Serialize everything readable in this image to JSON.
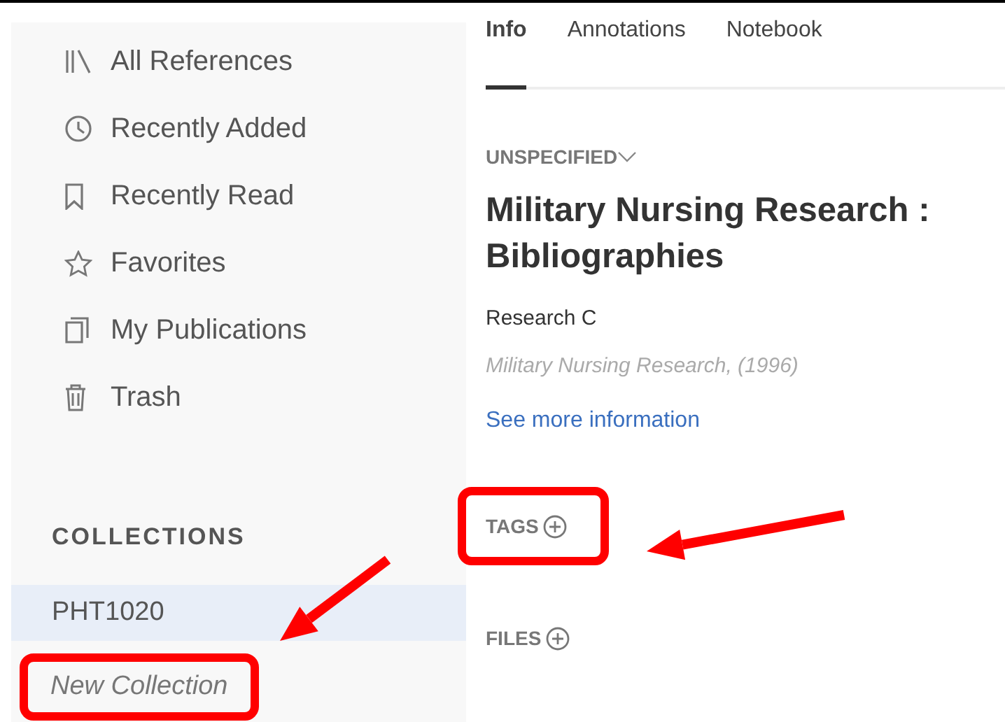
{
  "sidebar": {
    "library_items": [
      {
        "label": "All References"
      },
      {
        "label": "Recently Added"
      },
      {
        "label": "Recently Read"
      },
      {
        "label": "Favorites"
      },
      {
        "label": "My Publications"
      },
      {
        "label": "Trash"
      }
    ],
    "collections_heading": "COLLECTIONS",
    "collections": [
      {
        "label": "PHT1020",
        "kind": "collection",
        "selected": true,
        "highlighted": false
      },
      {
        "label": "New Collection",
        "kind": "new",
        "selected": false,
        "highlighted": true
      }
    ]
  },
  "tabs": [
    {
      "label": "Info",
      "selected": true
    },
    {
      "label": "Annotations",
      "selected": false
    },
    {
      "label": "Notebook",
      "selected": false
    }
  ],
  "item": {
    "type_label": "UNSPECIFIED",
    "title": "Military Nursing Research : Bibliographies",
    "author": "Research C",
    "source": "Military Nursing Research, (1996)",
    "more_link": "See more information"
  },
  "sections": [
    {
      "label": "TAGS",
      "highlighted": true
    },
    {
      "label": "FILES",
      "highlighted": false
    }
  ]
}
